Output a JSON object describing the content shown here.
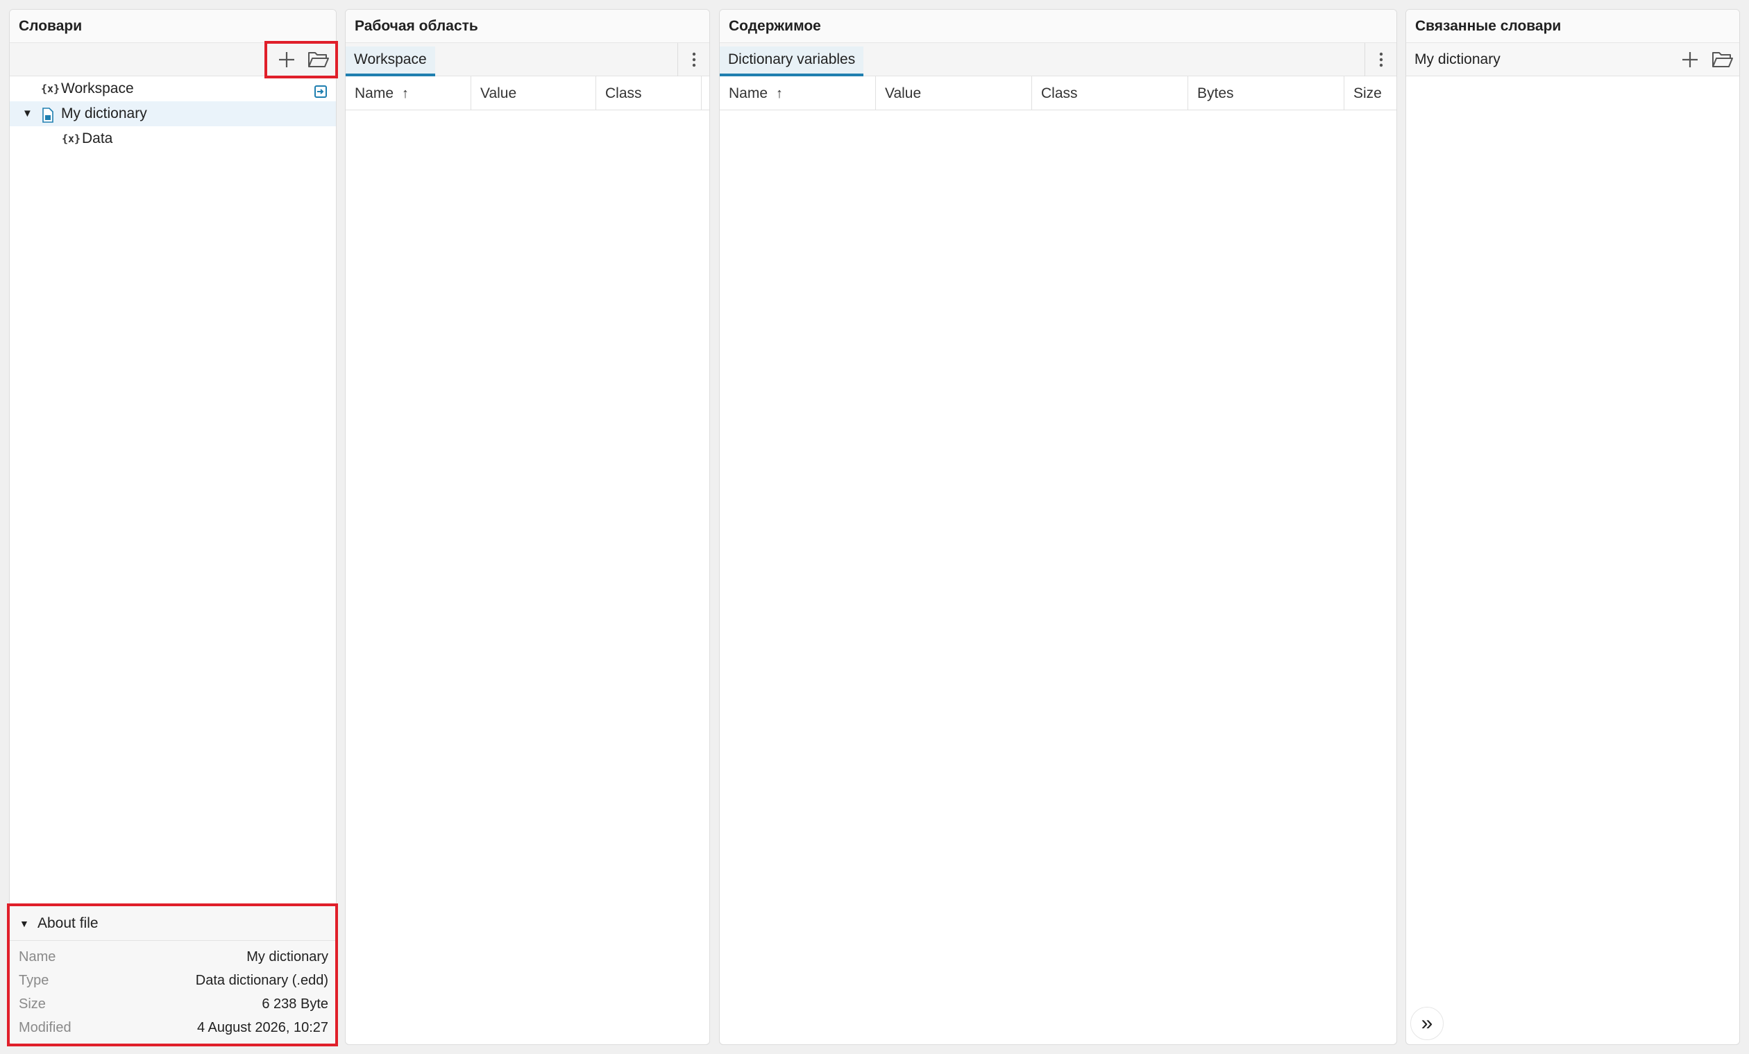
{
  "dictionaries_panel": {
    "title": "Словари",
    "tree": [
      {
        "label": "Workspace",
        "icon": "variable-workspace-icon"
      },
      {
        "label": "My dictionary",
        "icon": "dictionary-file-icon",
        "expanded": true,
        "selected": true
      },
      {
        "label": "Data",
        "icon": "variable-set-icon"
      }
    ],
    "about": {
      "title": "About file",
      "rows": [
        {
          "key": "Name",
          "value": "My dictionary"
        },
        {
          "key": "Type",
          "value": "Data dictionary (.edd)"
        },
        {
          "key": "Size",
          "value": "6 238 Byte"
        },
        {
          "key": "Modified",
          "value": "4 August 2026, 10:27"
        }
      ]
    }
  },
  "workspace_panel": {
    "title": "Рабочая область",
    "tab": "Workspace",
    "columns": [
      "Name",
      "Value",
      "Class"
    ],
    "sort_column": "Name",
    "rows": []
  },
  "contents_panel": {
    "title": "Содержимое",
    "tab": "Dictionary variables",
    "columns": [
      "Name",
      "Value",
      "Class",
      "Bytes",
      "Size"
    ],
    "sort_column": "Name",
    "rows": []
  },
  "linked_panel": {
    "title": "Связанные словари",
    "item": "My dictionary"
  },
  "colors": {
    "accent": "#1f7fb0",
    "highlight": "#e01f2a",
    "selected_row": "#eaf3fa"
  }
}
